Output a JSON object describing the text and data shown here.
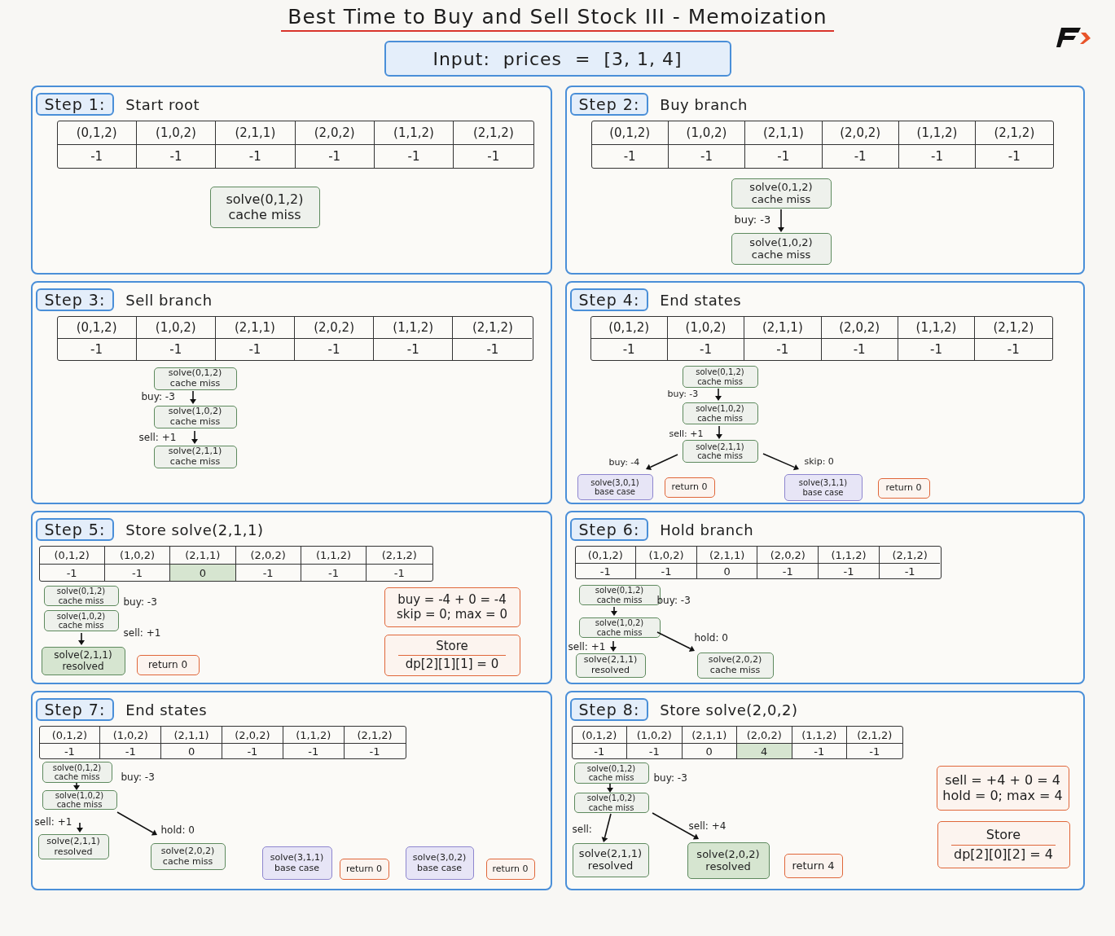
{
  "title": "Best Time to Buy and Sell Stock III - Memoization",
  "input": "Input:  prices  =  [3, 1, 4]",
  "steps": [
    {
      "label": "Step 1:",
      "caption": "Start root",
      "table": [
        {
          "key": "(0,1,2)",
          "value": "-1",
          "highlighted": false
        },
        {
          "key": "(1,0,2)",
          "value": "-1",
          "highlighted": false
        },
        {
          "key": "(2,1,1)",
          "value": "-1",
          "highlighted": false
        },
        {
          "key": "(2,0,2)",
          "value": "-1",
          "highlighted": false
        },
        {
          "key": "(1,1,2)",
          "value": "-1",
          "highlighted": false
        },
        {
          "key": "(2,1,2)",
          "value": "-1",
          "highlighted": false
        }
      ],
      "nodes": [
        {
          "kind": "miss",
          "lines": [
            "solve(0,1,2)",
            "cache miss"
          ]
        }
      ]
    },
    {
      "label": "Step 2:",
      "caption": "Buy branch",
      "table": [
        {
          "key": "(0,1,2)",
          "value": "-1",
          "highlighted": false
        },
        {
          "key": "(1,0,2)",
          "value": "-1",
          "highlighted": false
        },
        {
          "key": "(2,1,1)",
          "value": "-1",
          "highlighted": false
        },
        {
          "key": "(2,0,2)",
          "value": "-1",
          "highlighted": false
        },
        {
          "key": "(1,1,2)",
          "value": "-1",
          "highlighted": false
        },
        {
          "key": "(2,1,2)",
          "value": "-1",
          "highlighted": false
        }
      ],
      "nodes": [
        {
          "kind": "miss",
          "lines": [
            "solve(0,1,2)",
            "cache miss"
          ]
        },
        {
          "kind": "miss",
          "lines": [
            "solve(1,0,2)",
            "cache miss"
          ]
        }
      ],
      "edge_labels": [
        "buy: -3"
      ]
    },
    {
      "label": "Step 3:",
      "caption": "Sell branch",
      "table": [
        {
          "key": "(0,1,2)",
          "value": "-1",
          "highlighted": false
        },
        {
          "key": "(1,0,2)",
          "value": "-1",
          "highlighted": false
        },
        {
          "key": "(2,1,1)",
          "value": "-1",
          "highlighted": false
        },
        {
          "key": "(2,0,2)",
          "value": "-1",
          "highlighted": false
        },
        {
          "key": "(1,1,2)",
          "value": "-1",
          "highlighted": false
        },
        {
          "key": "(2,1,2)",
          "value": "-1",
          "highlighted": false
        }
      ],
      "nodes": [
        {
          "kind": "miss",
          "lines": [
            "solve(0,1,2)",
            "cache miss"
          ]
        },
        {
          "kind": "miss",
          "lines": [
            "solve(1,0,2)",
            "cache miss"
          ]
        },
        {
          "kind": "miss",
          "lines": [
            "solve(2,1,1)",
            "cache miss"
          ]
        }
      ],
      "edge_labels": [
        "buy: -3",
        "sell: +1"
      ]
    },
    {
      "label": "Step 4:",
      "caption": "End states",
      "table": [
        {
          "key": "(0,1,2)",
          "value": "-1",
          "highlighted": false
        },
        {
          "key": "(1,0,2)",
          "value": "-1",
          "highlighted": false
        },
        {
          "key": "(2,1,1)",
          "value": "-1",
          "highlighted": false
        },
        {
          "key": "(2,0,2)",
          "value": "-1",
          "highlighted": false
        },
        {
          "key": "(1,1,2)",
          "value": "-1",
          "highlighted": false
        },
        {
          "key": "(2,1,2)",
          "value": "-1",
          "highlighted": false
        }
      ],
      "nodes": [
        {
          "kind": "miss",
          "lines": [
            "solve(0,1,2)",
            "cache miss"
          ]
        },
        {
          "kind": "miss",
          "lines": [
            "solve(1,0,2)",
            "cache miss"
          ]
        },
        {
          "kind": "miss",
          "lines": [
            "solve(2,1,1)",
            "cache miss"
          ]
        },
        {
          "kind": "base",
          "lines": [
            "solve(3,0,1)",
            "base case"
          ]
        },
        {
          "kind": "return",
          "lines": [
            "return 0"
          ]
        },
        {
          "kind": "base",
          "lines": [
            "solve(3,1,1)",
            "base case"
          ]
        },
        {
          "kind": "return",
          "lines": [
            "return 0"
          ]
        }
      ],
      "edge_labels": [
        "buy: -3",
        "sell: +1",
        "buy: -4",
        "skip: 0"
      ]
    },
    {
      "label": "Step 5:",
      "caption": "Store solve(2,1,1)",
      "table": [
        {
          "key": "(0,1,2)",
          "value": "-1",
          "highlighted": false
        },
        {
          "key": "(1,0,2)",
          "value": "-1",
          "highlighted": false
        },
        {
          "key": "(2,1,1)",
          "value": "0",
          "highlighted": true
        },
        {
          "key": "(2,0,2)",
          "value": "-1",
          "highlighted": false
        },
        {
          "key": "(1,1,2)",
          "value": "-1",
          "highlighted": false
        },
        {
          "key": "(2,1,2)",
          "value": "-1",
          "highlighted": false
        }
      ],
      "nodes": [
        {
          "kind": "miss",
          "lines": [
            "solve(0,1,2)",
            "cache miss"
          ]
        },
        {
          "kind": "miss",
          "lines": [
            "solve(1,0,2)",
            "cache miss"
          ]
        },
        {
          "kind": "just_resolved",
          "lines": [
            "solve(2,1,1)",
            "resolved"
          ]
        },
        {
          "kind": "return",
          "lines": [
            "return 0"
          ]
        },
        {
          "kind": "calc",
          "lines": [
            "buy = -4 + 0 = -4",
            "skip = 0; max = 0"
          ]
        },
        {
          "kind": "store",
          "lines": [
            "Store",
            "dp[2][1][1] = 0"
          ]
        }
      ],
      "edge_labels": [
        "buy: -3",
        "sell: +1"
      ]
    },
    {
      "label": "Step 6:",
      "caption": "Hold branch",
      "table": [
        {
          "key": "(0,1,2)",
          "value": "-1",
          "highlighted": false
        },
        {
          "key": "(1,0,2)",
          "value": "-1",
          "highlighted": false
        },
        {
          "key": "(2,1,1)",
          "value": "0",
          "highlighted": false
        },
        {
          "key": "(2,0,2)",
          "value": "-1",
          "highlighted": false
        },
        {
          "key": "(1,1,2)",
          "value": "-1",
          "highlighted": false
        },
        {
          "key": "(2,1,2)",
          "value": "-1",
          "highlighted": false
        }
      ],
      "nodes": [
        {
          "kind": "miss",
          "lines": [
            "solve(0,1,2)",
            "cache miss"
          ]
        },
        {
          "kind": "miss",
          "lines": [
            "solve(1,0,2)",
            "cache miss"
          ]
        },
        {
          "kind": "resolved",
          "lines": [
            "solve(2,1,1)",
            "resolved"
          ]
        },
        {
          "kind": "miss",
          "lines": [
            "solve(2,0,2)",
            "cache miss"
          ]
        }
      ],
      "edge_labels": [
        "buy: -3",
        "hold: 0",
        "sell: +1"
      ]
    },
    {
      "label": "Step 7:",
      "caption": "End states",
      "table": [
        {
          "key": "(0,1,2)",
          "value": "-1",
          "highlighted": false
        },
        {
          "key": "(1,0,2)",
          "value": "-1",
          "highlighted": false
        },
        {
          "key": "(2,1,1)",
          "value": "0",
          "highlighted": false
        },
        {
          "key": "(2,0,2)",
          "value": "-1",
          "highlighted": false
        },
        {
          "key": "(1,1,2)",
          "value": "-1",
          "highlighted": false
        },
        {
          "key": "(2,1,2)",
          "value": "-1",
          "highlighted": false
        }
      ],
      "nodes": [
        {
          "kind": "miss",
          "lines": [
            "solve(0,1,2)",
            "cache miss"
          ]
        },
        {
          "kind": "miss",
          "lines": [
            "solve(1,0,2)",
            "cache miss"
          ]
        },
        {
          "kind": "resolved",
          "lines": [
            "solve(2,1,1)",
            "resolved"
          ]
        },
        {
          "kind": "miss",
          "lines": [
            "solve(2,0,2)",
            "cache miss"
          ]
        },
        {
          "kind": "base",
          "lines": [
            "solve(3,1,1)",
            "base case"
          ]
        },
        {
          "kind": "return",
          "lines": [
            "return 0"
          ]
        },
        {
          "kind": "base",
          "lines": [
            "solve(3,0,2)",
            "base case"
          ]
        },
        {
          "kind": "return",
          "lines": [
            "return 0"
          ]
        }
      ],
      "edge_labels": [
        "buy: -3",
        "sell: +1",
        "hold: 0"
      ]
    },
    {
      "label": "Step 8:",
      "caption": "Store solve(2,0,2)",
      "table": [
        {
          "key": "(0,1,2)",
          "value": "-1",
          "highlighted": false
        },
        {
          "key": "(1,0,2)",
          "value": "-1",
          "highlighted": false
        },
        {
          "key": "(2,1,1)",
          "value": "0",
          "highlighted": false
        },
        {
          "key": "(2,0,2)",
          "value": "4",
          "highlighted": true
        },
        {
          "key": "(1,1,2)",
          "value": "-1",
          "highlighted": false
        },
        {
          "key": "(2,1,2)",
          "value": "-1",
          "highlighted": false
        }
      ],
      "nodes": [
        {
          "kind": "miss",
          "lines": [
            "solve(0,1,2)",
            "cache miss"
          ]
        },
        {
          "kind": "miss",
          "lines": [
            "solve(1,0,2)",
            "cache miss"
          ]
        },
        {
          "kind": "resolved",
          "lines": [
            "solve(2,1,1)",
            "resolved"
          ]
        },
        {
          "kind": "just_resolved",
          "lines": [
            "solve(2,0,2)",
            "resolved"
          ]
        },
        {
          "kind": "return",
          "lines": [
            "return 4"
          ]
        },
        {
          "kind": "calc",
          "lines": [
            "sell = +4 + 0 = 4",
            "hold = 0; max = 4"
          ]
        },
        {
          "kind": "store",
          "lines": [
            "Store",
            "dp[2][0][2] = 4"
          ]
        }
      ],
      "edge_labels": [
        "buy: -3",
        "sell:",
        "sell: +4"
      ]
    }
  ]
}
